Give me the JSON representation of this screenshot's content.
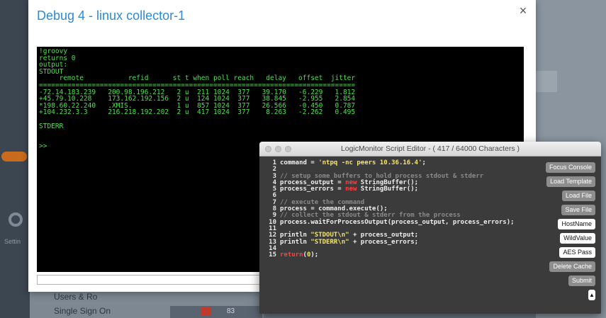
{
  "background": {
    "settings_label": "Settin",
    "list_items": [
      "Users & Ro",
      "Single Sign On"
    ],
    "table_number": "83"
  },
  "modal": {
    "title": "Debug 4 - linux collector-1",
    "close_glyph": "×",
    "console_output": "!groovy\nreturns 0\noutput:\nSTDOUT\n     remote           refid      st t when poll reach   delay   offset  jitter\n==============================================================================\n-72.14.183.239   200.98.196.212   2 u  211 1024  377   39.170   -6.229   1.812\n+45.79.10.228    173.162.192.156  2 u  124 1024  377   38.845   -2.955   2.854\n*198.60.22.240   .XMIS.           1 u  857 1024  377   26.566   -0.450   0.787\n+104.232.3.3     216.218.192.202  2 u  417 1024  377    8.263   -2.262   0.495\n\nSTDERR\n\n\n>>"
  },
  "editor": {
    "title": "LogicMonitor Script Editor - ( 417 / 64000 Characters )",
    "code_lines": [
      {
        "n": "1",
        "parts": [
          {
            "t": "command = ",
            "c": "fn"
          },
          {
            "t": "'ntpq -nc peers 10.36.16.4'",
            "c": "str"
          },
          {
            "t": ";",
            "c": "fn"
          }
        ]
      },
      {
        "n": "2",
        "parts": []
      },
      {
        "n": "3",
        "parts": [
          {
            "t": "// setup some buffers to hold process stdout & stderr",
            "c": "com"
          }
        ]
      },
      {
        "n": "4",
        "parts": [
          {
            "t": "process_output = ",
            "c": "fn"
          },
          {
            "t": "new",
            "c": "kw"
          },
          {
            "t": " StringBuffer();",
            "c": "fn"
          }
        ]
      },
      {
        "n": "5",
        "parts": [
          {
            "t": "process_errors = ",
            "c": "fn"
          },
          {
            "t": "new",
            "c": "kw"
          },
          {
            "t": " StringBuffer();",
            "c": "fn"
          }
        ]
      },
      {
        "n": "6",
        "parts": []
      },
      {
        "n": "7",
        "parts": [
          {
            "t": "// execute the command",
            "c": "com"
          }
        ]
      },
      {
        "n": "8",
        "parts": [
          {
            "t": "process = command.execute();",
            "c": "fn"
          }
        ]
      },
      {
        "n": "9",
        "parts": [
          {
            "t": "// collect the stdout & stderr from the process",
            "c": "com"
          }
        ]
      },
      {
        "n": "10",
        "parts": [
          {
            "t": "process.waitForProcessOutput(process_output, process_errors);",
            "c": "fn"
          }
        ]
      },
      {
        "n": "11",
        "parts": []
      },
      {
        "n": "12",
        "parts": [
          {
            "t": "println ",
            "c": "fn"
          },
          {
            "t": "\"STDOUT\\n\"",
            "c": "str"
          },
          {
            "t": " + process_output;",
            "c": "fn"
          }
        ]
      },
      {
        "n": "13",
        "parts": [
          {
            "t": "println ",
            "c": "fn"
          },
          {
            "t": "\"STDERR\\n\"",
            "c": "str"
          },
          {
            "t": " + process_errors;",
            "c": "fn"
          }
        ]
      },
      {
        "n": "14",
        "parts": []
      },
      {
        "n": "15",
        "parts": [
          {
            "t": "return",
            "c": "kw"
          },
          {
            "t": "(",
            "c": "fn"
          },
          {
            "t": "0",
            "c": "str"
          },
          {
            "t": ");",
            "c": "fn"
          }
        ]
      }
    ],
    "buttons": {
      "focus_console": "Focus Console",
      "load_template": "Load Template",
      "load_file": "Load File",
      "save_file": "Save File",
      "hostname": "HostName",
      "wildvalue": "WildValue",
      "aes_pass": "AES Pass",
      "delete_cache": "Delete Cache",
      "submit": "Submit",
      "collapse": "▲"
    }
  }
}
